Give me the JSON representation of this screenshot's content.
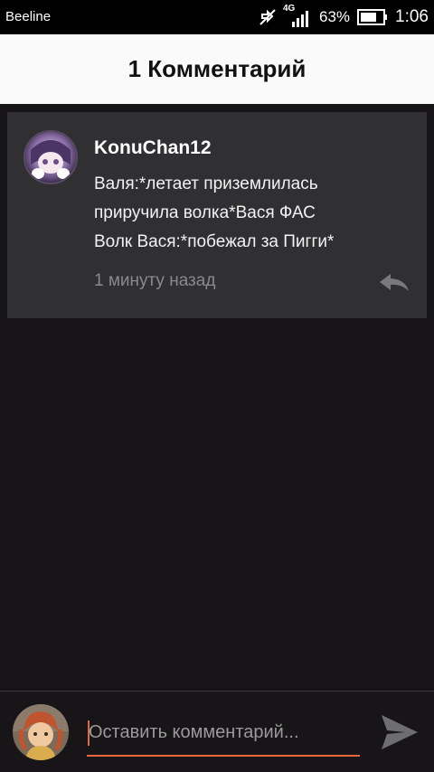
{
  "status_bar": {
    "carrier": "Beeline",
    "network_type": "4G",
    "battery_percent": "63%",
    "time": "1:06",
    "icons": [
      "mute-icon",
      "signal-icon",
      "battery-icon"
    ]
  },
  "header": {
    "title": "1 Комментарий"
  },
  "comment": {
    "username": "KonuChan12",
    "text_lines": [
      "Валя:*летает приземлилась",
      "приручила волка*Вася ФАС",
      "Волк Вася:*побежал за Пигги*"
    ],
    "timestamp": "1 минуту назад",
    "reply_icon": "reply-icon"
  },
  "composer": {
    "placeholder": "Оставить комментарий...",
    "value": "",
    "send_icon": "send-icon"
  },
  "colors": {
    "background": "#161416",
    "card": "#303032",
    "header": "#fafafa",
    "accent": "#e5673a",
    "muted_text": "#8a8a8a"
  }
}
